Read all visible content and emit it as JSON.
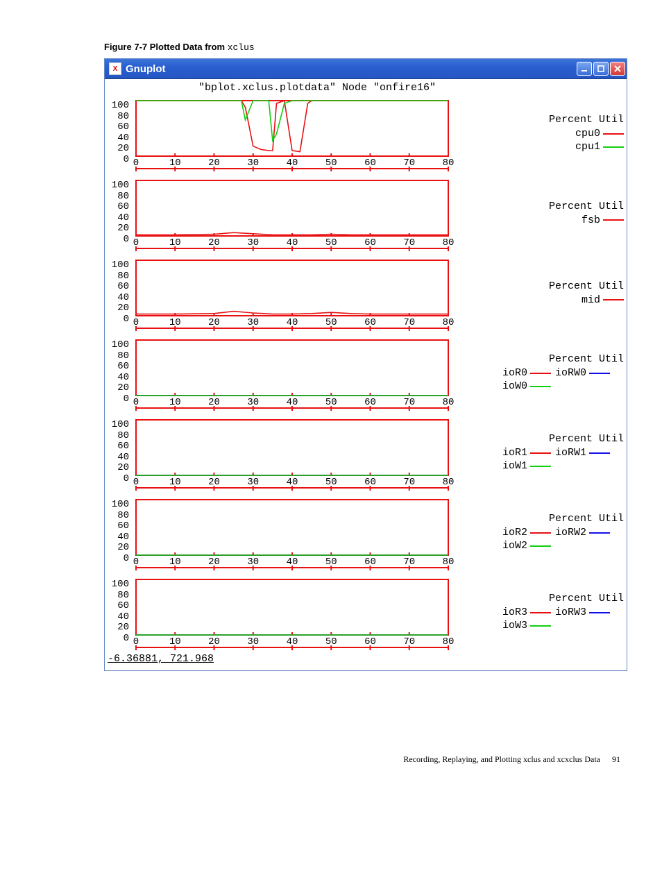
{
  "caption": {
    "label_bold": "Figure  7-7  Plotted Data from ",
    "label_mono": "xclus"
  },
  "window": {
    "title": "Gnuplot",
    "icon_glyph": "X",
    "controls": {
      "min": "_",
      "max": "□",
      "close": "×"
    }
  },
  "plot": {
    "title": "\"bplot.xclus.plotdata\" Node \"onfire16\"",
    "status_line": "-6.36881,  721.968",
    "y_ticks": [
      "100",
      "80",
      "60",
      "40",
      "20",
      "0"
    ],
    "x_ticks": [
      "0",
      "10",
      "20",
      "30",
      "40",
      "50",
      "60",
      "70",
      "80"
    ]
  },
  "chart_data": [
    {
      "type": "line",
      "title": "Percent Util",
      "ylim": [
        0,
        100
      ],
      "x": [
        0,
        5,
        10,
        15,
        20,
        25,
        27,
        28,
        30,
        32,
        34,
        35,
        36,
        38,
        40,
        42,
        44,
        45,
        47,
        50,
        55,
        60,
        65,
        70,
        75,
        80
      ],
      "series": [
        {
          "name": "cpu0",
          "color": "red",
          "values": [
            100,
            100,
            100,
            100,
            100,
            100,
            100,
            88,
            18,
            12,
            10,
            10,
            95,
            100,
            10,
            8,
            95,
            100,
            100,
            100,
            100,
            100,
            100,
            100,
            100,
            100
          ]
        },
        {
          "name": "cpu1",
          "color": "green",
          "values": [
            100,
            100,
            100,
            100,
            100,
            100,
            100,
            65,
            100,
            100,
            100,
            28,
            40,
            95,
            100,
            100,
            100,
            100,
            100,
            100,
            100,
            100,
            100,
            100,
            100,
            100
          ]
        }
      ]
    },
    {
      "type": "line",
      "title": "Percent Util",
      "ylim": [
        0,
        100
      ],
      "x": [
        0,
        10,
        20,
        25,
        30,
        35,
        40,
        45,
        50,
        55,
        60,
        70,
        80
      ],
      "series": [
        {
          "name": "fsb",
          "color": "red",
          "values": [
            2,
            2,
            3,
            6,
            4,
            2,
            2,
            2,
            3,
            2,
            2,
            2,
            2
          ]
        }
      ]
    },
    {
      "type": "line",
      "title": "Percent Util",
      "ylim": [
        0,
        100
      ],
      "x": [
        0,
        10,
        20,
        25,
        30,
        35,
        40,
        45,
        50,
        55,
        60,
        70,
        80
      ],
      "series": [
        {
          "name": "mid",
          "color": "red",
          "values": [
            3,
            3,
            4,
            8,
            5,
            3,
            3,
            4,
            6,
            4,
            3,
            3,
            3
          ]
        }
      ]
    },
    {
      "type": "line",
      "title": "Percent Util",
      "ylim": [
        0,
        100
      ],
      "x": [
        0,
        10,
        20,
        30,
        40,
        50,
        60,
        70,
        80
      ],
      "series": [
        {
          "name": "ioR0",
          "color": "red",
          "values": [
            0,
            0,
            0,
            0,
            0,
            0,
            0,
            0,
            0
          ]
        },
        {
          "name": "ioRW0",
          "color": "blue",
          "values": [
            0,
            0,
            0,
            0,
            0,
            0,
            0,
            0,
            0
          ]
        },
        {
          "name": "ioW0",
          "color": "green",
          "values": [
            0,
            0,
            0,
            0,
            0,
            0,
            0,
            0,
            0
          ]
        }
      ]
    },
    {
      "type": "line",
      "title": "Percent Util",
      "ylim": [
        0,
        100
      ],
      "x": [
        0,
        10,
        20,
        30,
        40,
        50,
        60,
        70,
        80
      ],
      "series": [
        {
          "name": "ioR1",
          "color": "red",
          "values": [
            0,
            0,
            0,
            0,
            0,
            0,
            0,
            0,
            0
          ]
        },
        {
          "name": "ioRW1",
          "color": "blue",
          "values": [
            0,
            0,
            0,
            0,
            0,
            0,
            0,
            0,
            0
          ]
        },
        {
          "name": "ioW1",
          "color": "green",
          "values": [
            0,
            0,
            0,
            0,
            0,
            0,
            0,
            0,
            0
          ]
        }
      ]
    },
    {
      "type": "line",
      "title": "Percent Util",
      "ylim": [
        0,
        100
      ],
      "x": [
        0,
        10,
        20,
        30,
        40,
        50,
        60,
        70,
        80
      ],
      "series": [
        {
          "name": "ioR2",
          "color": "red",
          "values": [
            0,
            0,
            0,
            0,
            0,
            0,
            0,
            0,
            0
          ]
        },
        {
          "name": "ioRW2",
          "color": "blue",
          "values": [
            0,
            0,
            0,
            0,
            0,
            0,
            0,
            0,
            0
          ]
        },
        {
          "name": "ioW2",
          "color": "green",
          "values": [
            0,
            0,
            0,
            0,
            0,
            0,
            0,
            0,
            0
          ]
        }
      ]
    },
    {
      "type": "line",
      "title": "Percent Util",
      "ylim": [
        0,
        100
      ],
      "x": [
        0,
        10,
        20,
        30,
        40,
        50,
        60,
        70,
        80
      ],
      "series": [
        {
          "name": "ioR3",
          "color": "red",
          "values": [
            0,
            0,
            0,
            0,
            0,
            0,
            0,
            0,
            0
          ]
        },
        {
          "name": "ioRW3",
          "color": "blue",
          "values": [
            0,
            0,
            0,
            0,
            0,
            0,
            0,
            0,
            0
          ]
        },
        {
          "name": "ioW3",
          "color": "green",
          "values": [
            0,
            0,
            0,
            0,
            0,
            0,
            0,
            0,
            0
          ]
        }
      ]
    }
  ],
  "footer": {
    "text": "Recording, Replaying, and Plotting xclus and xcxclus Data",
    "page": "91"
  }
}
